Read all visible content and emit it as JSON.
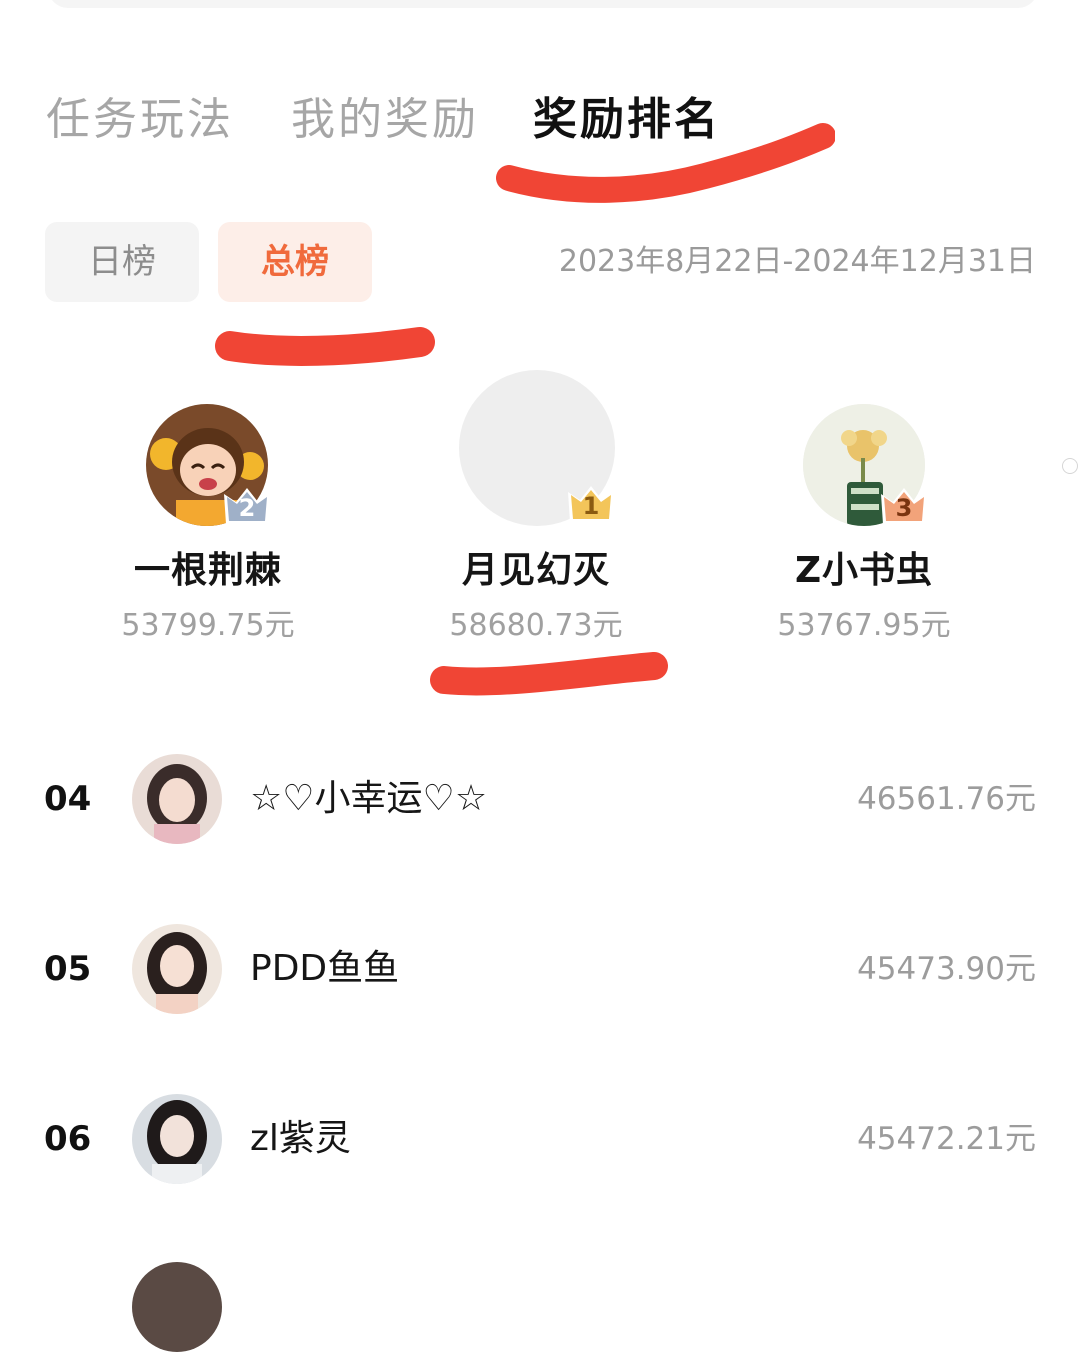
{
  "tabs": [
    {
      "label": "任务玩法",
      "active": false
    },
    {
      "label": "我的奖励",
      "active": false
    },
    {
      "label": "奖励排名",
      "active": true
    }
  ],
  "board_switch": {
    "daily_label": "日榜",
    "total_label": "总榜",
    "selected": "总榜",
    "date_range": "2023年8月22日-2024年12月31日"
  },
  "podium": [
    {
      "rank": "2",
      "name": "一根荆棘",
      "amount": "53799.75元",
      "crown_color": "#9fb0c8"
    },
    {
      "rank": "1",
      "name": "月见幻灭",
      "amount": "58680.73元",
      "crown_color": "#f3c55a"
    },
    {
      "rank": "3",
      "name": "Z小书虫",
      "amount": "53767.95元",
      "crown_color": "#f2a37a"
    }
  ],
  "ranking_list": [
    {
      "rank": "04",
      "name": "☆♡小幸运♡☆",
      "amount": "46561.76元"
    },
    {
      "rank": "05",
      "name": "PDD鱼鱼",
      "amount": "45473.90元"
    },
    {
      "rank": "06",
      "name": "zl紫灵",
      "amount": "45472.21元"
    }
  ],
  "colors": {
    "accent": "#f06a3c",
    "accent_bg": "#fdeee8",
    "marker_red": "#ef3b2a",
    "muted_text": "#a0a0a0"
  }
}
